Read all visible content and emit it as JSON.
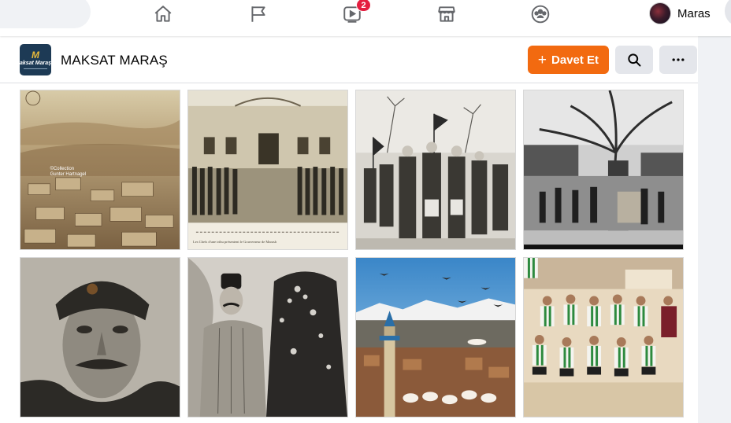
{
  "nav": {
    "video_badge": "2",
    "profile_name": "Maras",
    "icons": [
      "home-icon",
      "flag-icon",
      "video-icon",
      "marketplace-icon",
      "groups-icon"
    ]
  },
  "page": {
    "logo_mark": "M",
    "logo_text": "aksat Maraş",
    "title": "MAKSAT MARAŞ",
    "invite_plus": "+",
    "invite_label": "Davet Et"
  },
  "photos": [
    {
      "name": "photo-historic-town-panorama",
      "watermark_1": "©Collection",
      "watermark_2": "Gunter Hartnagel"
    },
    {
      "name": "photo-government-building-crowd",
      "caption": "Les Chefs d'une tribu présentent le Gouverneur de Marash"
    },
    {
      "name": "photo-militia-marching-flags"
    },
    {
      "name": "photo-market-under-tree"
    },
    {
      "name": "photo-mustached-man-portrait"
    },
    {
      "name": "photo-couple-traditional-dress"
    },
    {
      "name": "photo-minaret-with-birds"
    },
    {
      "name": "photo-football-team"
    }
  ],
  "colors": {
    "accent": "#f26a10",
    "badge": "#e41e3f",
    "icon": "#65676b"
  }
}
